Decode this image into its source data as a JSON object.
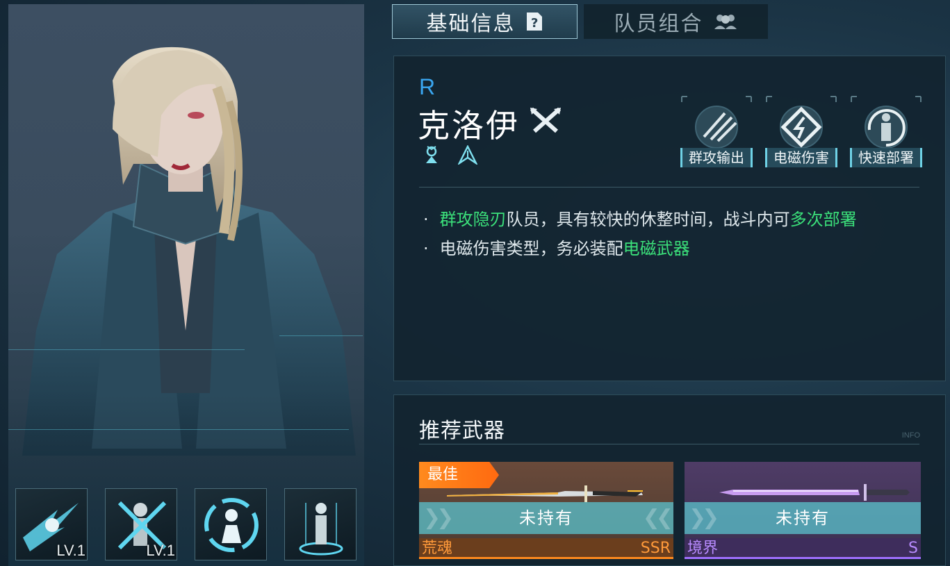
{
  "tabs": {
    "basic_info": "基础信息",
    "team_combo": "队员组合"
  },
  "character": {
    "rarity": "R",
    "name": "克洛伊",
    "class_icon": "crossed-blades-icon",
    "type_icons": [
      "crowned-figure-icon",
      "split-ribbon-icon"
    ],
    "tags": [
      "群攻输出",
      "电磁伤害",
      "快速部署"
    ]
  },
  "description": {
    "line1": {
      "hl1": "群攻隐刃",
      "text": "队员，具有较快的休整时间，战斗内可",
      "hl2": "多次部署"
    },
    "line2": {
      "text": "电磁伤害类型，务必装配",
      "hl": "电磁武器"
    }
  },
  "skills": [
    {
      "icon": "dash-strike-icon",
      "level": "LV.1"
    },
    {
      "icon": "disable-soldiers-icon",
      "level": "LV.1"
    },
    {
      "icon": "redeploy-cycle-icon",
      "level": ""
    },
    {
      "icon": "hologram-figure-icon",
      "level": ""
    }
  ],
  "weapons": {
    "title": "推荐武器",
    "hint": "INFO",
    "items": [
      {
        "badge": "最佳",
        "status": "未持有",
        "name": "荒魂",
        "rarity": "SSR",
        "color": "#ff8a1e"
      },
      {
        "badge": "",
        "status": "未持有",
        "name": "境界",
        "rarity": "S",
        "color": "#a070ff"
      }
    ]
  },
  "colors": {
    "highlight": "#3be07a",
    "rarity_r": "#3aa6f0",
    "accent_cyan": "#6fd2e6"
  }
}
